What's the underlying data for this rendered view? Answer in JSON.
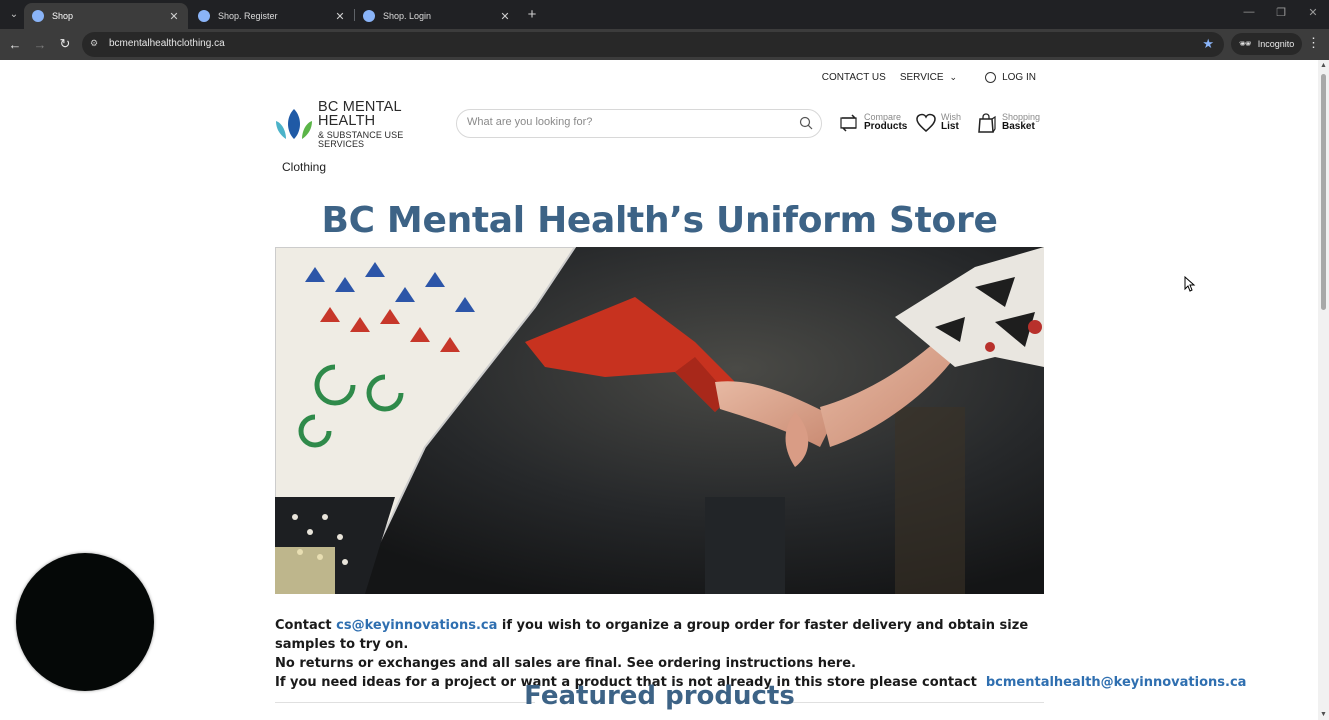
{
  "browser": {
    "tabs": [
      {
        "title": "Shop",
        "active": true
      },
      {
        "title": "Shop. Register",
        "active": false
      },
      {
        "title": "Shop. Login",
        "active": false
      }
    ],
    "url": "bcmentalhealthclothing.ca",
    "incognito_label": "Incognito",
    "icons": {
      "back": "back-arrow-icon",
      "forward": "forward-arrow-icon",
      "reload": "reload-icon",
      "bookmark": "star-icon",
      "menu": "kebab-icon"
    }
  },
  "header": {
    "topnav": {
      "contact": "CONTACT US",
      "service": "SERVICE",
      "login": "LOG IN"
    },
    "logo": {
      "line1": "BC MENTAL HEALTH",
      "line2": "& SUBSTANCE USE SERVICES"
    },
    "search": {
      "placeholder": "What are you looking for?"
    },
    "actions": {
      "compare": {
        "top": "Compare",
        "bottom": "Products"
      },
      "wishlist": {
        "top": "Wish",
        "bottom": "List"
      },
      "basket": {
        "top": "Shopping",
        "bottom": "Basket"
      }
    },
    "category": "Clothing"
  },
  "main": {
    "title": "BC Mental Health’s Uniform Store",
    "info": {
      "line1_prefix": "Contact ",
      "line1_email": "cs@keyinnovations.ca",
      "line1_suffix": " if you wish to organize a group order for faster delivery and obtain size samples to try on.",
      "line2": "No returns or exchanges and all sales are final. See ordering instructions here.",
      "line3_prefix": "If you need ideas for a project or want a product that is not already in this store please contact  ",
      "line3_email": "bcmentalhealth@keyinnovations.ca"
    },
    "featured_title": "Featured products"
  },
  "colors": {
    "brand_blue": "#3d6386",
    "link_blue": "#2f6fb0",
    "chrome_dark": "#202124",
    "chrome_toolbar": "#3c3c3c"
  }
}
